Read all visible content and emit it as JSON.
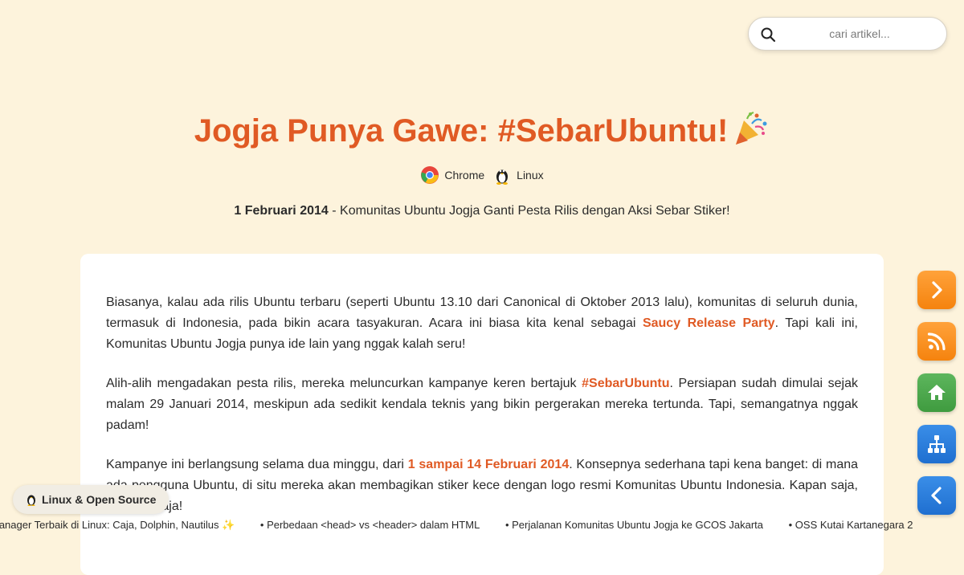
{
  "search": {
    "placeholder": "cari artikel..."
  },
  "article": {
    "title": "Jogja Punya Gawe: #SebarUbuntu!",
    "tags": [
      {
        "label": "Chrome",
        "icon": "chrome-icon"
      },
      {
        "label": "Linux",
        "icon": "tux-icon"
      }
    ],
    "date": "1 Februari 2014",
    "subtitle": " - Komunitas Ubuntu Jogja Ganti Pesta Rilis dengan Aksi Sebar Stiker!",
    "paragraphs": [
      {
        "before": "Biasanya, kalau ada rilis Ubuntu terbaru (seperti Ubuntu 13.10 dari Canonical di Oktober 2013 lalu), komunitas di seluruh dunia, termasuk di Indonesia, pada bikin acara tasyakuran. Acara ini biasa kita kenal sebagai ",
        "link": "Saucy Release Party",
        "after": ". Tapi kali ini, Komunitas Ubuntu Jogja punya ide lain yang nggak kalah seru!"
      },
      {
        "before": "Alih-alih mengadakan pesta rilis, mereka meluncurkan kampanye keren bertajuk ",
        "link": "#SebarUbuntu",
        "after": ". Persiapan sudah dimulai sejak malam 29 Januari 2014, meskipun ada sedikit kendala teknis yang bikin pergerakan mereka tertunda. Tapi, semangatnya nggak padam!"
      },
      {
        "before": "Kampanye ini berlangsung selama dua minggu, dari ",
        "link": "1 sampai 14 Februari 2014",
        "after": ". Konsepnya sederhana tapi kena banget: di mana ada pengguna Ubuntu, di situ mereka akan membagikan stiker kece dengan logo resmi Komunitas Ubuntu Indonesia. Kapan saja, di mana saja!"
      }
    ]
  },
  "sidebar_buttons": [
    {
      "name": "next-button",
      "icon": "chevron-right-icon",
      "color": "#f5830e"
    },
    {
      "name": "rss-button",
      "icon": "rss-icon",
      "color": "#f5830e"
    },
    {
      "name": "home-button",
      "icon": "home-icon",
      "color": "#3f9b3f"
    },
    {
      "name": "sitemap-button",
      "icon": "sitemap-icon",
      "color": "#1f6fd0"
    },
    {
      "name": "prev-button",
      "icon": "chevron-left-icon",
      "color": "#1f6fd0"
    }
  ],
  "category": {
    "label": "Linux & Open Source",
    "icon": "penguin-icon"
  },
  "ticker": [
    "Manager Terbaik di Linux: Caja, Dolphin, Nautilus ✨",
    "• Perbedaan <head> vs <header> dalam HTML",
    "• Perjalanan Komunitas Ubuntu Jogja ke GCOS Jakarta",
    "• OSS Kutai Kartanegara 2"
  ],
  "colors": {
    "accent": "#e05a24",
    "background": "#fdf3dc"
  }
}
